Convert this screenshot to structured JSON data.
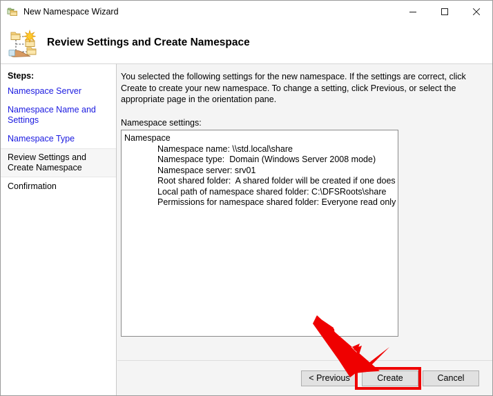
{
  "window": {
    "title": "New Namespace Wizard",
    "title_icon": "namespace-folders-icon",
    "caption": {
      "minimize": "minimize-icon",
      "maximize": "maximize-icon",
      "close": "close-icon"
    }
  },
  "header": {
    "icon": "new-namespace-wizard-icon",
    "title": "Review Settings and Create Namespace"
  },
  "sidebar": {
    "label": "Steps:",
    "items": [
      {
        "label": "Namespace Server",
        "state": "done"
      },
      {
        "label": "Namespace Name and Settings",
        "state": "done"
      },
      {
        "label": "Namespace Type",
        "state": "done"
      },
      {
        "label": "Review Settings and Create Namespace",
        "state": "current"
      },
      {
        "label": "Confirmation",
        "state": "upcoming"
      }
    ]
  },
  "content": {
    "intro": "You selected the following settings for the new namespace. If the settings are correct, click Create to create your new namespace. To change a setting, click Previous, or select the appropriate page in the orientation pane.",
    "settings_label": "Namespace settings:",
    "settings_box": {
      "heading": "Namespace",
      "lines": [
        "Namespace name: \\\\std.local\\share",
        "Namespace type:  Domain (Windows Server 2008 mode)",
        "Namespace server: srv01",
        "Root shared folder:  A shared folder will be created if one does not exist.",
        "Local path of namespace shared folder: C:\\DFSRoots\\share",
        "Permissions for namespace shared folder: Everyone read only"
      ]
    }
  },
  "buttons": {
    "previous": "< Previous",
    "create": "Create",
    "cancel": "Cancel"
  },
  "annotation": {
    "arrow_color": "#ef0000",
    "highlight_color": "#ef0000",
    "highlight_target": "create"
  },
  "colors": {
    "link": "#1a19e0",
    "content_bg": "#f4f4f4",
    "button_bg": "#e1e1e1"
  }
}
